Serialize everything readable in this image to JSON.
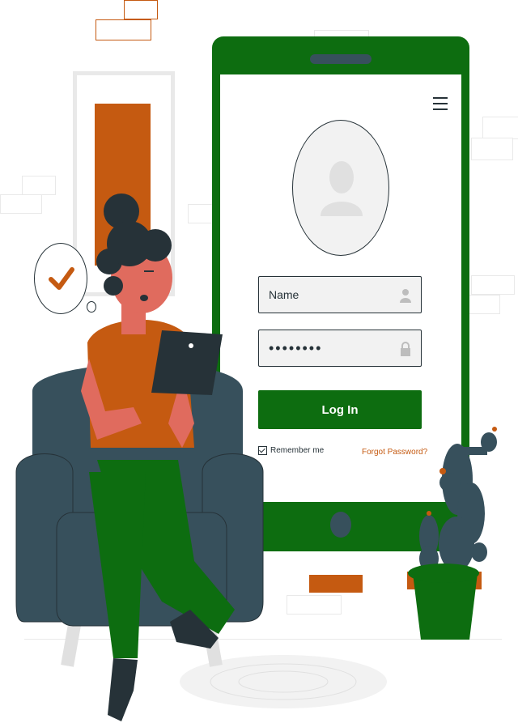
{
  "login_form": {
    "name_placeholder": "Name",
    "password_value": "••••••••",
    "login_label": "Log In",
    "remember_label": "Remember me",
    "remember_checked": true,
    "forgot_label": "Forgot Password?"
  },
  "icons": [
    "menu-icon",
    "user-avatar-icon",
    "user-icon",
    "lock-icon",
    "check-icon",
    "checkbox-icon"
  ],
  "colors": {
    "brand_green": "#0d6d10",
    "accent_orange": "#c55a11",
    "dark_slate": "#37505c",
    "ink": "#263238",
    "skin": "#e06b5e"
  }
}
